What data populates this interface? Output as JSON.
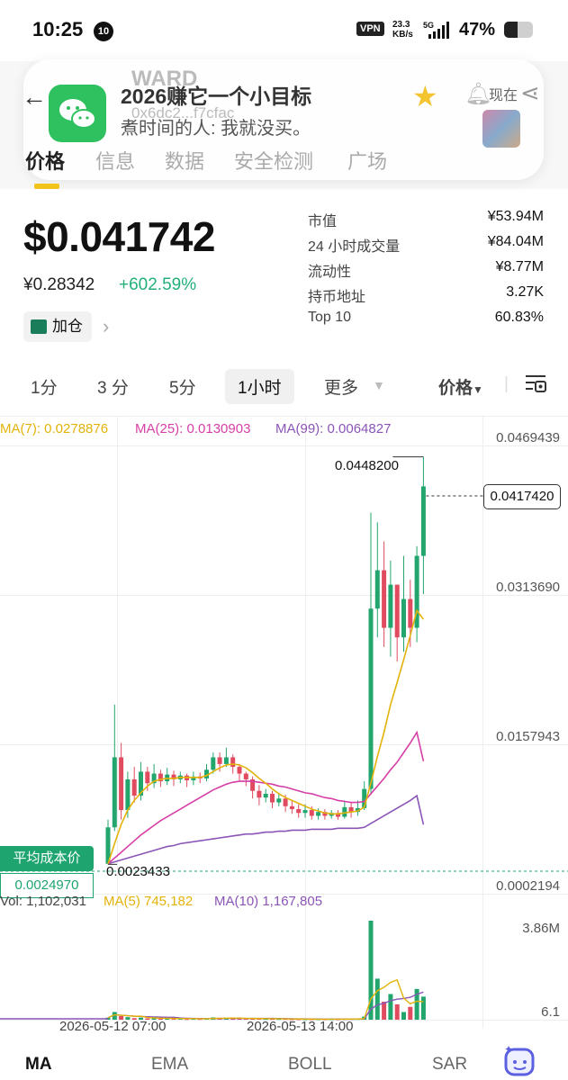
{
  "status_bar": {
    "time": "10:25",
    "badge": "10",
    "vpn": "VPN",
    "speed_value": "23.3",
    "speed_unit": "KB/s",
    "network": "5G",
    "battery_pct": "47%",
    "battery_level": 0.47
  },
  "header": {
    "back_icon": "back-arrow-icon",
    "app_icon": "wechat-icon",
    "token_symbol": "WARD",
    "token_title": "2026赚它一个小目标",
    "contract_address": "0x6dc2...f7cfac",
    "subtitle": "煮时间的人: 我就没买。",
    "now_label": "现在",
    "tabs": [
      {
        "label": "价格",
        "active": true
      },
      {
        "label": "信息",
        "active": false
      },
      {
        "label": "数据",
        "active": false
      },
      {
        "label": "安全检测",
        "active": false
      },
      {
        "label": "广场",
        "active": false
      }
    ]
  },
  "summary": {
    "price_usd": "$0.041742",
    "price_cny": "¥0.28342",
    "change_pct": "+602.59%",
    "add_button": "加仓",
    "stats": [
      {
        "label": "市值",
        "value": "¥53.94M"
      },
      {
        "label": "24 小时成交量",
        "value": "¥84.04M"
      },
      {
        "label": "流动性",
        "value": "¥8.77M"
      },
      {
        "label": "持币地址",
        "value": "3.27K"
      },
      {
        "label": "Top 10",
        "value": "60.83%"
      }
    ]
  },
  "intervals": {
    "items": [
      "1分",
      "3 分",
      "5分",
      "1小时",
      "更多"
    ],
    "active": "1小时",
    "price_toggle": "价格"
  },
  "chart_data": {
    "type": "candlestick",
    "ma_legend": [
      {
        "label": "MA(7): 0.0278876",
        "color": "#e3b30a"
      },
      {
        "label": "MA(25): 0.0130903",
        "color": "#d63fa6"
      },
      {
        "label": "MA(99): 0.0064827",
        "color": "#8a55b7"
      }
    ],
    "y_ticks": [
      "0.0469439",
      "0.0313690",
      "0.0157943",
      "0.0002194"
    ],
    "ylim": [
      0.0002194,
      0.0469439
    ],
    "max_label": "0.0448200",
    "current_label": "0.0417420",
    "min_label": "0.0023433",
    "avg_cost_button": "平均成本价",
    "avg_cost_value": "0.0024970",
    "volume_legend": [
      {
        "label": "Vol: 1,102,031",
        "color": "#444444"
      },
      {
        "label": "MA(5) 745,182",
        "color": "#e3b30a"
      },
      {
        "label": "MA(10) 1,167,805",
        "color": "#8a55b7"
      }
    ],
    "volume_ticks": [
      "3.86M",
      "6.1"
    ],
    "x_labels": [
      "2026-05-12 07:00",
      "2026-05-13 14:00"
    ],
    "up_color": "#22a66e",
    "down_color": "#e04b5f",
    "candles": [
      [
        0.0024,
        0.0062,
        0.0023433,
        0.007
      ],
      [
        0.0062,
        0.0135,
        0.0058,
        0.019
      ],
      [
        0.0135,
        0.008,
        0.007,
        0.015
      ],
      [
        0.008,
        0.0112,
        0.0072,
        0.012
      ],
      [
        0.0112,
        0.0095,
        0.0088,
        0.0125
      ],
      [
        0.0095,
        0.012,
        0.009,
        0.013
      ],
      [
        0.012,
        0.0108,
        0.01,
        0.0125
      ],
      [
        0.0108,
        0.0118,
        0.0103,
        0.0128
      ],
      [
        0.0118,
        0.011,
        0.0104,
        0.0122
      ],
      [
        0.011,
        0.0117,
        0.0106,
        0.0124
      ],
      [
        0.0117,
        0.0112,
        0.0105,
        0.0121
      ],
      [
        0.0112,
        0.0116,
        0.0108,
        0.012
      ],
      [
        0.0116,
        0.0111,
        0.0104,
        0.0118
      ],
      [
        0.0111,
        0.0115,
        0.0106,
        0.012
      ],
      [
        0.0115,
        0.0113,
        0.0108,
        0.0119
      ],
      [
        0.0113,
        0.0122,
        0.011,
        0.0128
      ],
      [
        0.0122,
        0.0135,
        0.0118,
        0.014
      ],
      [
        0.0135,
        0.0128,
        0.012,
        0.014
      ],
      [
        0.0128,
        0.0135,
        0.0125,
        0.0145
      ],
      [
        0.0135,
        0.0125,
        0.0118,
        0.0138
      ],
      [
        0.0125,
        0.0118,
        0.011,
        0.0128
      ],
      [
        0.0118,
        0.0112,
        0.0105,
        0.012
      ],
      [
        0.0112,
        0.01,
        0.0092,
        0.0115
      ],
      [
        0.01,
        0.0093,
        0.0085,
        0.0106
      ],
      [
        0.0093,
        0.0097,
        0.0088,
        0.0102
      ],
      [
        0.0097,
        0.0088,
        0.0082,
        0.01
      ],
      [
        0.0088,
        0.0092,
        0.0084,
        0.0098
      ],
      [
        0.0092,
        0.0084,
        0.0078,
        0.0096
      ],
      [
        0.0084,
        0.0081,
        0.0076,
        0.009
      ],
      [
        0.0081,
        0.0077,
        0.0072,
        0.0086
      ],
      [
        0.0077,
        0.008,
        0.0072,
        0.0086
      ],
      [
        0.008,
        0.0074,
        0.007,
        0.0084
      ],
      [
        0.0074,
        0.0078,
        0.007,
        0.0082
      ],
      [
        0.0078,
        0.0074,
        0.007,
        0.0081
      ],
      [
        0.0074,
        0.0077,
        0.0071,
        0.008
      ],
      [
        0.0077,
        0.0073,
        0.007,
        0.008
      ],
      [
        0.0073,
        0.0083,
        0.0071,
        0.009
      ],
      [
        0.0083,
        0.0078,
        0.0072,
        0.0088
      ],
      [
        0.0078,
        0.0082,
        0.0074,
        0.009
      ],
      [
        0.0082,
        0.0102,
        0.008,
        0.011
      ],
      [
        0.0102,
        0.029,
        0.0098,
        0.039
      ],
      [
        0.029,
        0.033,
        0.026,
        0.038
      ],
      [
        0.033,
        0.027,
        0.025,
        0.036
      ],
      [
        0.027,
        0.0315,
        0.024,
        0.034
      ],
      [
        0.0315,
        0.026,
        0.0235,
        0.03
      ],
      [
        0.026,
        0.03,
        0.0245,
        0.0345
      ],
      [
        0.03,
        0.027,
        0.025,
        0.032
      ],
      [
        0.027,
        0.0345,
        0.0255,
        0.0355
      ],
      [
        0.0345,
        0.041742,
        0.0305,
        0.04482
      ]
    ],
    "ma7": [
      0.0024,
      0.0045,
      0.0065,
      0.008,
      0.009,
      0.0098,
      0.0105,
      0.011,
      0.0112,
      0.0113,
      0.0113,
      0.0114,
      0.0114,
      0.0114,
      0.0114,
      0.0116,
      0.012,
      0.0124,
      0.0127,
      0.0128,
      0.0127,
      0.0124,
      0.0119,
      0.0113,
      0.0108,
      0.0102,
      0.0097,
      0.0093,
      0.009,
      0.0087,
      0.0084,
      0.0081,
      0.0079,
      0.0077,
      0.0076,
      0.0076,
      0.0077,
      0.0078,
      0.0079,
      0.0083,
      0.0108,
      0.0136,
      0.0161,
      0.019,
      0.0213,
      0.0237,
      0.0262,
      0.0288,
      0.0278876
    ],
    "ma25": [
      0.0024,
      0.003,
      0.0036,
      0.0042,
      0.0048,
      0.0054,
      0.0059,
      0.0064,
      0.0069,
      0.0073,
      0.0077,
      0.0081,
      0.0085,
      0.0089,
      0.0093,
      0.0097,
      0.0101,
      0.0104,
      0.0107,
      0.0109,
      0.011,
      0.011,
      0.011,
      0.0109,
      0.0108,
      0.0107,
      0.0105,
      0.0104,
      0.0102,
      0.01,
      0.0098,
      0.0097,
      0.0095,
      0.0093,
      0.0092,
      0.009,
      0.0089,
      0.0088,
      0.0088,
      0.0089,
      0.0097,
      0.0105,
      0.0113,
      0.0122,
      0.013,
      0.014,
      0.015,
      0.0161,
      0.0130903
    ],
    "ma99": [
      0.0024,
      0.0026,
      0.0028,
      0.003,
      0.0032,
      0.0034,
      0.0036,
      0.0038,
      0.004,
      0.0042,
      0.0043,
      0.0045,
      0.0046,
      0.0047,
      0.0048,
      0.0049,
      0.005,
      0.0051,
      0.0052,
      0.0053,
      0.0054,
      0.0055,
      0.0055,
      0.0056,
      0.0057,
      0.0057,
      0.0058,
      0.0058,
      0.0059,
      0.0059,
      0.0059,
      0.006,
      0.006,
      0.006,
      0.006,
      0.0061,
      0.0061,
      0.0061,
      0.0061,
      0.0062,
      0.0066,
      0.007,
      0.0074,
      0.0078,
      0.0082,
      0.0086,
      0.009,
      0.0095,
      0.0064827
    ],
    "volumes": [
      0.08,
      0.3,
      0.14,
      0.1,
      0.06,
      0.08,
      0.05,
      0.06,
      0.04,
      0.05,
      0.04,
      0.04,
      0.03,
      0.04,
      0.03,
      0.05,
      0.09,
      0.07,
      0.06,
      0.05,
      0.04,
      0.04,
      0.05,
      0.04,
      0.03,
      0.03,
      0.03,
      0.03,
      0.02,
      0.02,
      0.02,
      0.02,
      0.02,
      0.02,
      0.02,
      0.02,
      0.03,
      0.03,
      0.03,
      0.12,
      3.86,
      1.6,
      0.7,
      1.0,
      0.6,
      0.3,
      0.5,
      1.2,
      0.9
    ],
    "volume_unit": "M"
  },
  "bottom_tabs": [
    {
      "label": "MA",
      "active": true
    },
    {
      "label": "EMA",
      "active": false
    },
    {
      "label": "BOLL",
      "active": false
    },
    {
      "label": "SAR",
      "active": false
    }
  ]
}
